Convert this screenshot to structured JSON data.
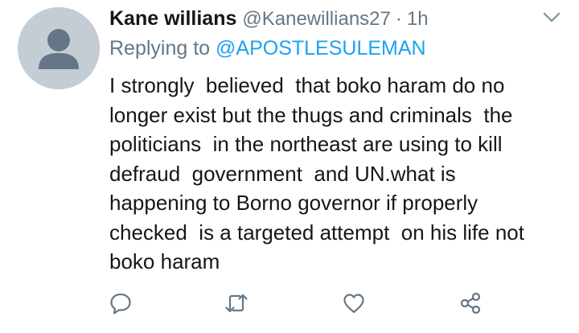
{
  "tweet": {
    "display_name": "Kane willians",
    "handle": "@Kanewillians27",
    "separator": "·",
    "time": "1h",
    "replying_prefix": "Replying to ",
    "replying_to": "@APOSTLESULEMAN",
    "text": "I strongly  believed  that boko haram do no\nlonger exist but the thugs and criminals  the\npoliticians  in the northeast are using to kill\ndefraud  government  and UN.what is\nhappening to Borno governor if properly\nchecked  is a targeted attempt  on his life not\nboko haram"
  },
  "icons": {
    "avatar": "default-avatar-icon",
    "menu": "chevron-down-icon",
    "reply": "reply-bubble-icon",
    "retweet": "retweet-icon",
    "like": "heart-icon",
    "share": "share-icon"
  },
  "colors": {
    "text_primary": "#14171a",
    "text_secondary": "#657786",
    "link": "#1da1f2",
    "icon_gray": "#657786",
    "avatar_bg": "#c4ccd4",
    "avatar_fg": "#657786"
  }
}
